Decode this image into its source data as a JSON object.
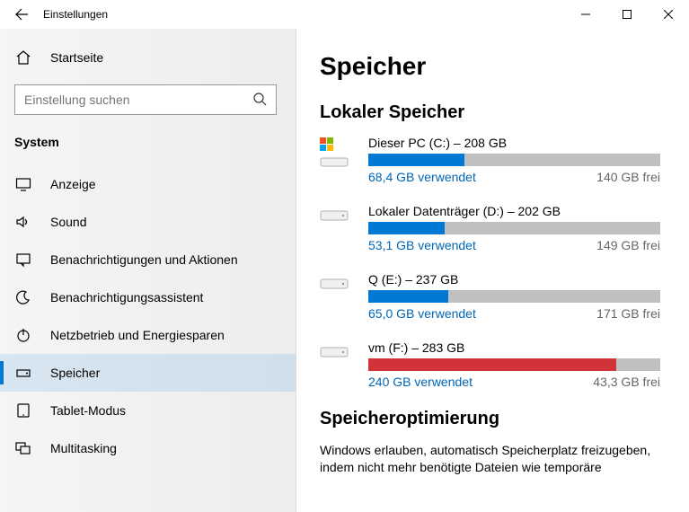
{
  "window": {
    "title": "Einstellungen"
  },
  "sidebar": {
    "home": "Startseite",
    "search_placeholder": "Einstellung suchen",
    "section": "System",
    "items": [
      {
        "label": "Anzeige",
        "icon": "display-icon"
      },
      {
        "label": "Sound",
        "icon": "sound-icon"
      },
      {
        "label": "Benachrichtigungen und Aktionen",
        "icon": "notifications-icon"
      },
      {
        "label": "Benachrichtigungsassistent",
        "icon": "moon-icon"
      },
      {
        "label": "Netzbetrieb und Energiesparen",
        "icon": "power-icon"
      },
      {
        "label": "Speicher",
        "icon": "storage-icon"
      },
      {
        "label": "Tablet-Modus",
        "icon": "tablet-icon"
      },
      {
        "label": "Multitasking",
        "icon": "multitasking-icon"
      }
    ],
    "selected_index": 5
  },
  "main": {
    "heading": "Speicher",
    "local_heading": "Lokaler Speicher",
    "drives": [
      {
        "title": "Dieser PC (C:) – 208 GB",
        "used": "68,4 GB verwendet",
        "free": "140 GB frei",
        "used_gb": 68.4,
        "total_gb": 208,
        "color": "blue",
        "windows": true
      },
      {
        "title": "Lokaler Datenträger (D:) – 202 GB",
        "used": "53,1 GB verwendet",
        "free": "149 GB frei",
        "used_gb": 53.1,
        "total_gb": 202,
        "color": "blue",
        "windows": false
      },
      {
        "title": "Q (E:) – 237 GB",
        "used": "65,0 GB verwendet",
        "free": "171 GB frei",
        "used_gb": 65.0,
        "total_gb": 237,
        "color": "blue",
        "windows": false
      },
      {
        "title": "vm (F:) – 283 GB",
        "used": "240 GB verwendet",
        "free": "43,3 GB frei",
        "used_gb": 240,
        "total_gb": 283,
        "color": "red",
        "windows": false
      }
    ],
    "opt_heading": "Speicheroptimierung",
    "opt_text": "Windows erlauben, automatisch Speicherplatz freizugeben, indem nicht mehr benötigte Dateien wie temporäre"
  }
}
